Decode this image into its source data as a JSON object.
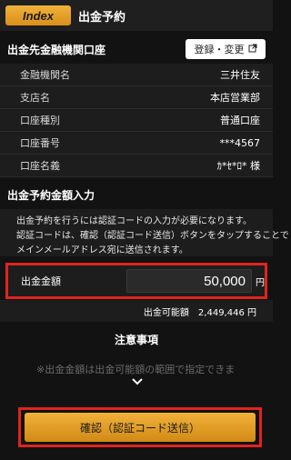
{
  "header": {
    "index_label": "Index",
    "title": "出金予約"
  },
  "account_section": {
    "title": "出金先金融機関口座",
    "register_button": "登録・変更",
    "rows": [
      {
        "label": "金融機関名",
        "value": "三井住友"
      },
      {
        "label": "支店名",
        "value": "本店営業部"
      },
      {
        "label": "口座種別",
        "value": "普通口座"
      },
      {
        "label": "口座番号",
        "value": "***4567"
      },
      {
        "label": "口座名義",
        "value": "ｶ*ｾ*ﾛ* 様"
      }
    ]
  },
  "amount_section": {
    "title": "出金予約金額入力",
    "notice_line1": "出金予約を行うには認証コードの入力が必要になります。",
    "notice_line2": "認証コードは、確認（認証コード送信）ボタンをタップすることで",
    "notice_line3": "メインメールアドレス宛に送信されます。",
    "amount_label": "出金金額",
    "amount_value": "50,000",
    "unit": "円",
    "available_label": "出金可能額",
    "available_value": "2,449,446 円"
  },
  "notes": {
    "title": "注意事項",
    "text": "※出金金額は出金可能額の範囲で指定できま"
  },
  "confirm_button": "確認（認証コード送信）",
  "colors": {
    "accent": "#e8a32a",
    "highlight": "#e0241f",
    "background": "#121212"
  }
}
